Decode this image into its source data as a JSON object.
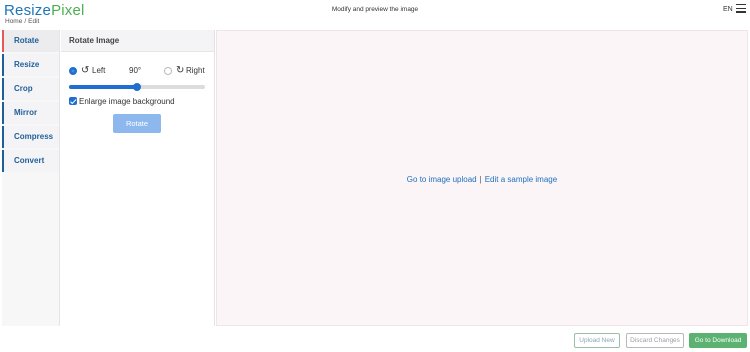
{
  "header": {
    "logo_part1": "Resize",
    "logo_part2": "Pixel",
    "heading": "Modify and preview the image",
    "language": "EN",
    "breadcrumb": {
      "home": "Home",
      "separator": "/",
      "current": "Edit"
    }
  },
  "sidebar": {
    "items": [
      {
        "label": "Rotate",
        "active": true
      },
      {
        "label": "Resize"
      },
      {
        "label": "Crop"
      },
      {
        "label": "Mirror"
      },
      {
        "label": "Compress"
      },
      {
        "label": "Convert"
      }
    ]
  },
  "panel": {
    "title": "Rotate Image",
    "left_label": "Left",
    "angle": "90°",
    "right_label": "Right",
    "selected_direction": "Left",
    "left_icon": "rotate-left-icon",
    "right_icon": "rotate-right-icon",
    "slider_value_fraction": 0.5,
    "enlarge_label": "Enlarge image background",
    "enlarge_checked": true,
    "rotate_button": "Rotate"
  },
  "preview": {
    "upload_link": "Go to image upload",
    "separator": "|",
    "sample_link": "Edit a sample image"
  },
  "footer": {
    "upload_new": "Upload New",
    "discard": "Discard Changes",
    "download": "Go to Download"
  },
  "colors": {
    "brand_blue": "#1b75bc",
    "brand_green": "#4caf50",
    "accent": "#1f6fd0",
    "active_marker": "#e45a5a",
    "download_green": "#5cb270"
  }
}
